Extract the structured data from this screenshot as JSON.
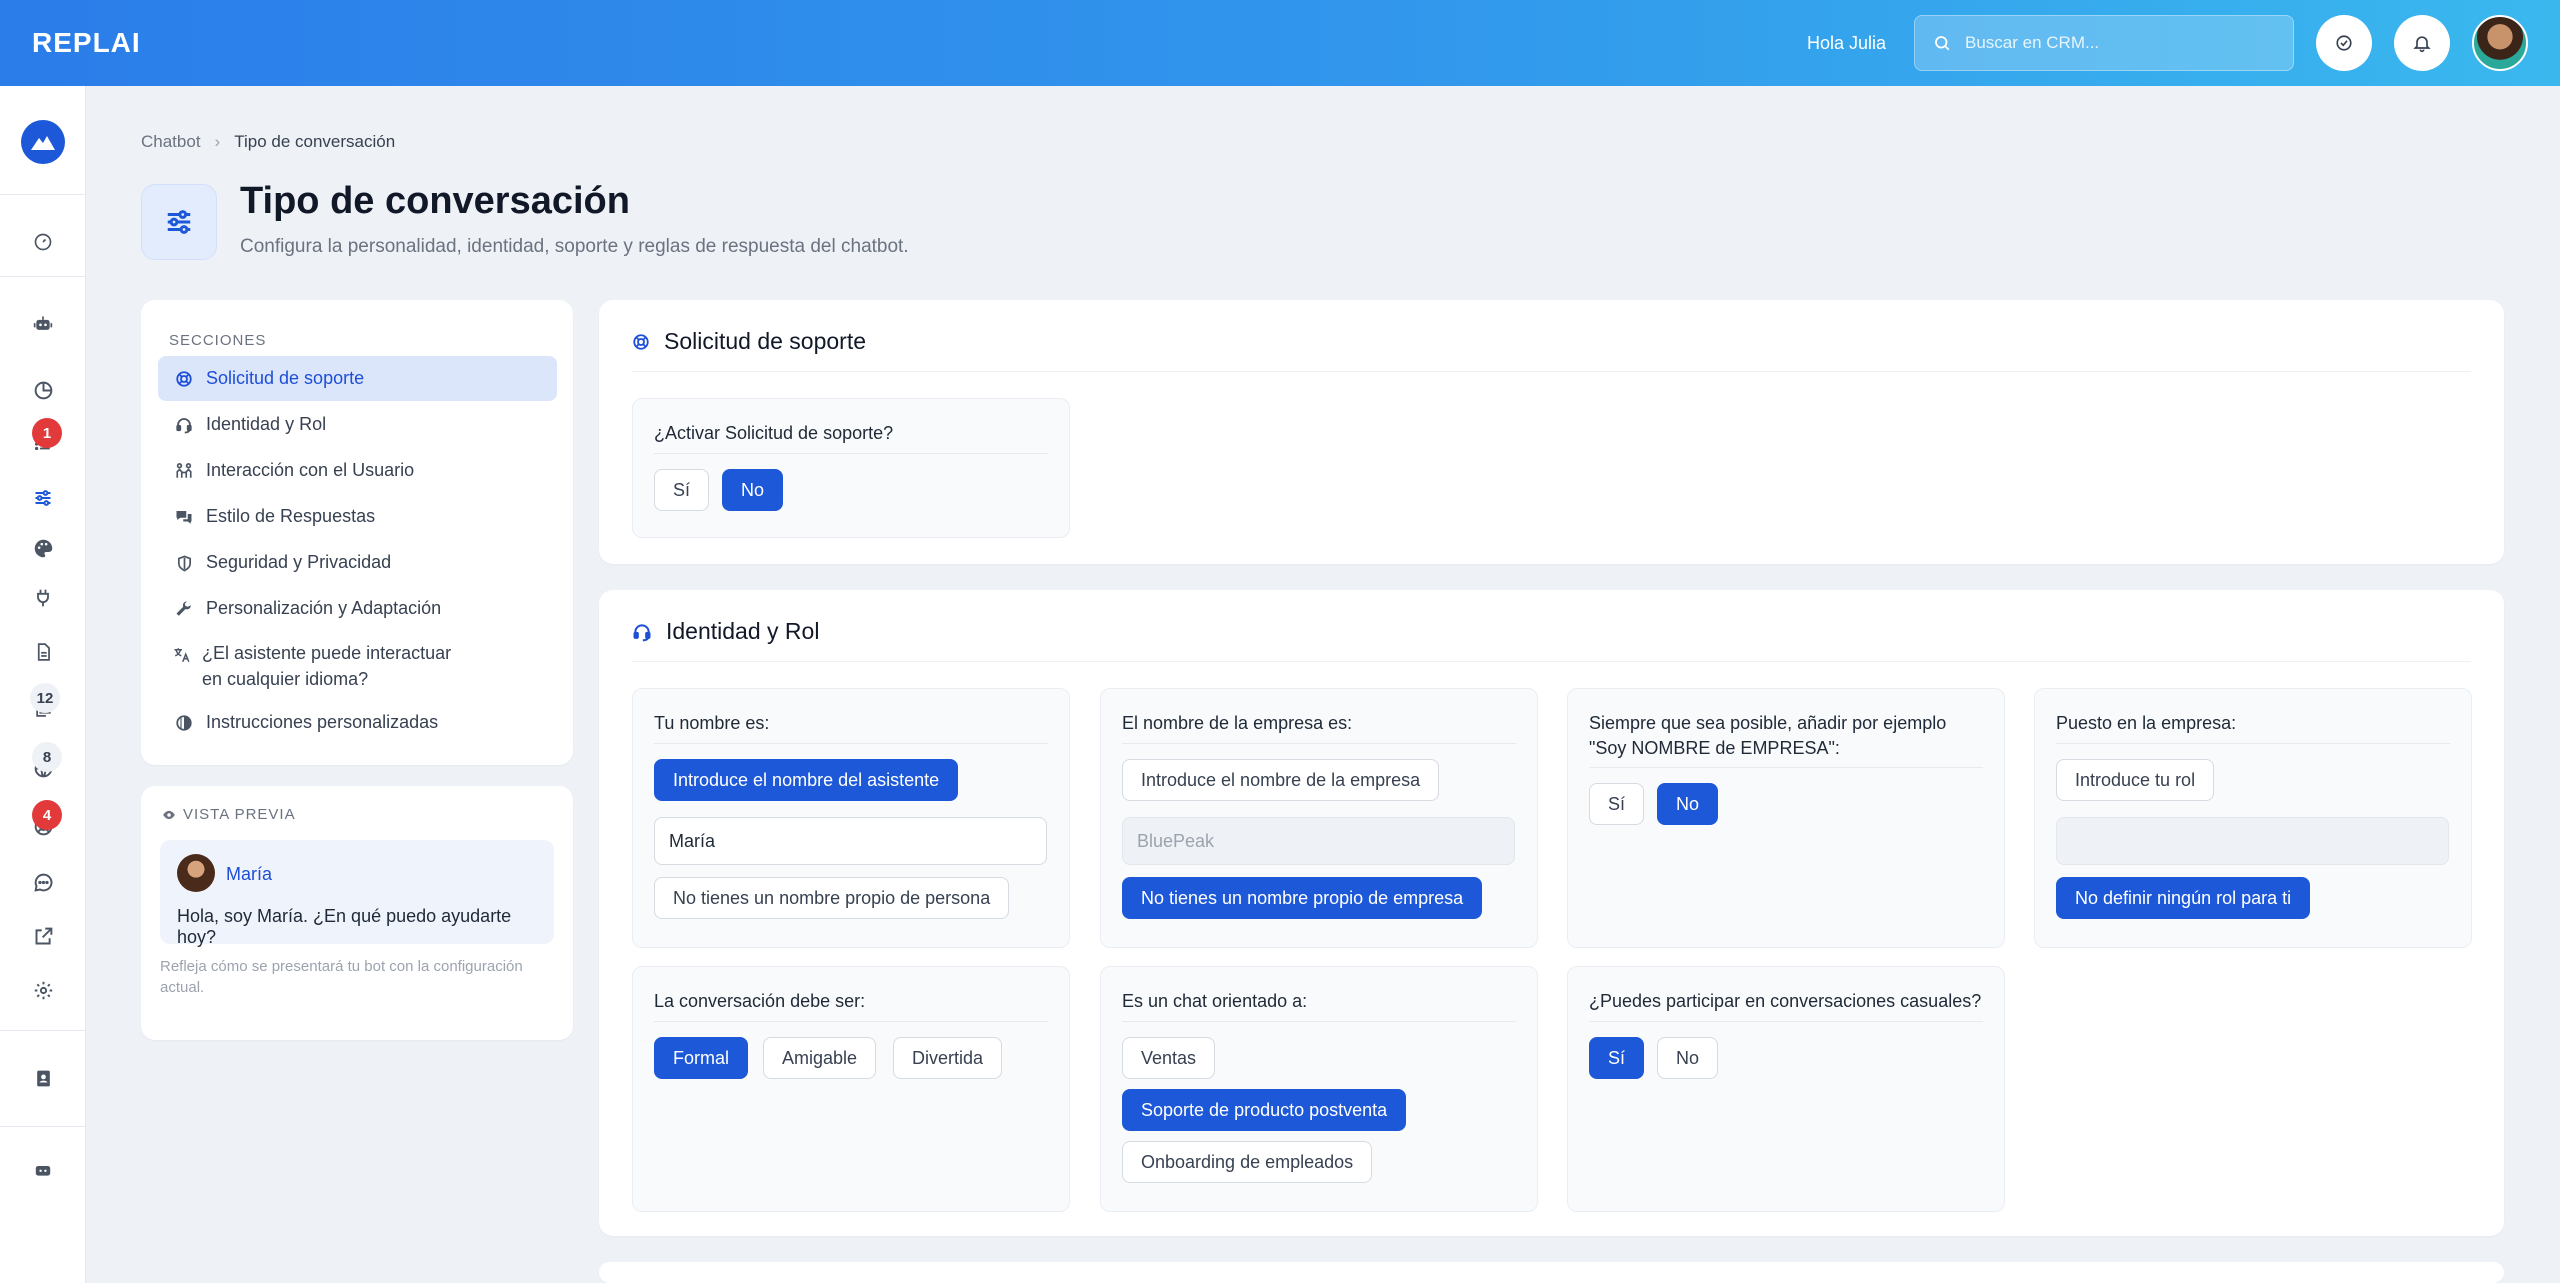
{
  "app": {
    "logo": "REPLAI"
  },
  "topbar": {
    "greeting": "Hola Julia",
    "search_placeholder": "Buscar en CRM..."
  },
  "sidenav": {
    "badges": {
      "list": "1",
      "docs": "12",
      "globe": "8",
      "support": "4"
    }
  },
  "breadcrumb": {
    "parent": "Chatbot",
    "current": "Tipo de conversación"
  },
  "header": {
    "title": "Tipo de conversación",
    "subtitle": "Configura la personalidad, identidad, soporte y reglas de respuesta del chatbot."
  },
  "sections": {
    "heading": "SECCIONES",
    "items": [
      {
        "label": "Solicitud de soporte"
      },
      {
        "label": "Identidad y Rol"
      },
      {
        "label": "Interacción con el Usuario"
      },
      {
        "label": "Estilo de Respuestas"
      },
      {
        "label": "Seguridad y Privacidad"
      },
      {
        "label": "Personalización y Adaptación"
      },
      {
        "label": "¿El asistente puede interactuar en cualquier idioma?"
      },
      {
        "label": "Instrucciones personalizadas"
      }
    ]
  },
  "preview": {
    "heading": "VISTA PREVIA",
    "bot_name": "María",
    "message": "Hola, soy María. ¿En qué puedo ayudarte hoy?",
    "note": "Refleja cómo se presentará tu bot con la configuración actual."
  },
  "support": {
    "title": "Solicitud de soporte",
    "question": "¿Activar Solicitud de soporte?",
    "yes": "Sí",
    "no": "No"
  },
  "identity": {
    "title": "Identidad y Rol",
    "name": {
      "label": "Tu nombre es:",
      "enter_btn": "Introduce el nombre del asistente",
      "value": "María",
      "none_btn": "No tienes un nombre propio de persona"
    },
    "company": {
      "label": "El nombre de la empresa es:",
      "enter_btn": "Introduce el nombre de la empresa",
      "placeholder": "BluePeak",
      "none_btn": "No tienes un nombre propio de empresa"
    },
    "add_company": {
      "label": "Siempre que sea posible, añadir por ejemplo \"Soy NOMBRE de EMPRESA\":",
      "yes": "Sí",
      "no": "No"
    },
    "role": {
      "label": "Puesto en la empresa:",
      "enter_btn": "Introduce tu rol",
      "value": "",
      "none_btn": "No definir ningún rol para ti"
    },
    "tone": {
      "label": "La conversación debe ser:",
      "options": [
        "Formal",
        "Amigable",
        "Divertida"
      ]
    },
    "orientation": {
      "label": "Es un chat orientado a:",
      "options": [
        "Ventas",
        "Soporte de producto postventa",
        "Onboarding de empleados"
      ]
    },
    "casual": {
      "label": "¿Puedes participar en conversaciones casuales?",
      "yes": "Sí",
      "no": "No"
    }
  },
  "colors": {
    "primary": "#1d58d8",
    "badge_red": "#e23a3a",
    "topbar_start": "#2b7de9",
    "topbar_end": "#3ab8ee"
  }
}
